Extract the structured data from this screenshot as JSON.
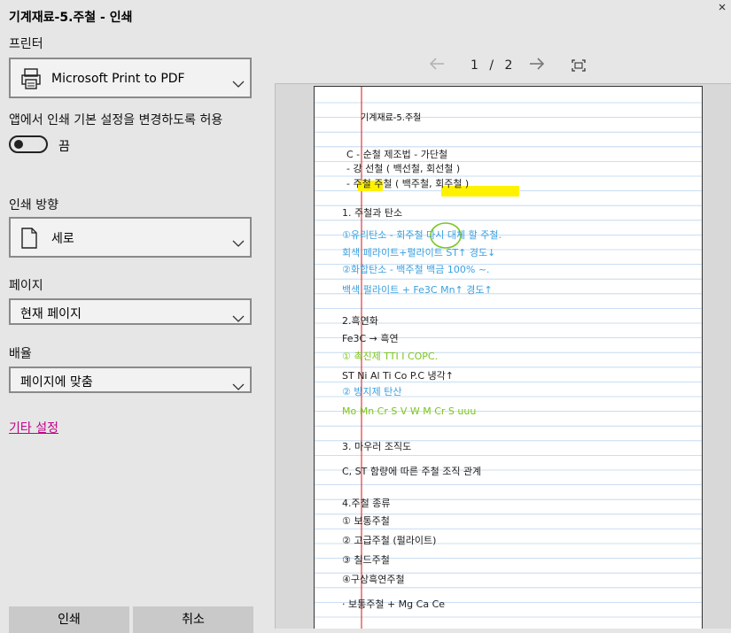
{
  "dialog": {
    "title": "기계재료-5.주철 - 인쇄",
    "close_icon": "close-icon"
  },
  "printer": {
    "label": "프린터",
    "selected": "Microsoft Print to PDF",
    "icon": "printer-icon"
  },
  "app_settings": {
    "label": "앱에서 인쇄 기본 설정을 변경하도록 허용",
    "toggle_state": "끔",
    "toggle_on": false
  },
  "orientation": {
    "label": "인쇄 방향",
    "selected": "세로",
    "icon": "portrait-page-icon"
  },
  "pages": {
    "label": "페이지",
    "selected": "현재 페이지"
  },
  "scale": {
    "label": "배율",
    "selected": "페이지에 맞춤"
  },
  "more_settings": "기타 설정",
  "buttons": {
    "print": "인쇄",
    "cancel": "취소"
  },
  "preview_nav": {
    "current_page": "1",
    "separator": "/",
    "total_pages": "2"
  },
  "document": {
    "header": "기계재료-5.주철",
    "lines": [
      "C - 순철   제조법 - 가단철",
      "   - 강          선철 ( 백선철, 회선철 )",
      "   - 주철        주철 ( 백주철, 회주철 )",
      "1. 주철과 탄소",
      "①유리탄소 - 회주철  다시 대체 할 주철.",
      "회색  페라이트+펄라이트 ST↑ 경도↓",
      "②화합탄소 - 백주철  백금 100% ~.",
      "백색  펄라이트 + Fe3C  Mn↑ 경도↑",
      "2.흑연화",
      "Fe3C → 흑연",
      "① 촉진제        TTI I COPC.",
      "ST  Ni  Al  Ti  Co   P.C   냉각↑",
      "② 방지제 탄산",
      "Mo  Mn  Cr  S  V  W    M  Cr  S  uuu",
      "3. 마우러 조직도",
      "C, ST 함량에 따른 주철 조직 관계",
      "4.주철 종류",
      "① 보통주철",
      "② 고급주철 (펄라이트)",
      "③ 칠드주철",
      "④구상흑연주철",
      "· 보통주철 + Mg  Ca  Ce"
    ]
  },
  "colors": {
    "accent_link": "#c2008a",
    "note_blue": "#3aa0e0",
    "note_green": "#7ac61a",
    "highlight": "#fff200",
    "margin_red": "#e23a3a",
    "rule_blue": "#b9d4ee"
  }
}
